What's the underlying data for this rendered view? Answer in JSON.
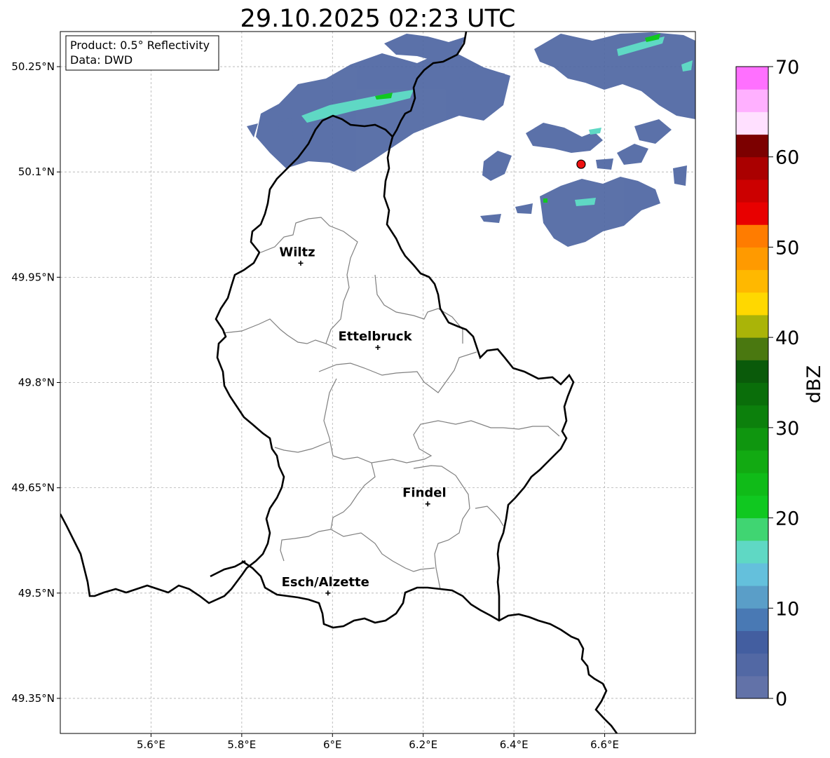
{
  "map": {
    "title": "29.10.2025 02:23 UTC",
    "info_box": {
      "product": "Product: 0.5° Reflectivity",
      "source": "Data: DWD"
    },
    "lon_range": [
      5.4,
      6.8
    ],
    "lat_range": [
      49.3,
      50.3
    ],
    "lon_ticks": [
      {
        "value": 5.6,
        "label": "5.6°E"
      },
      {
        "value": 5.8,
        "label": "5.8°E"
      },
      {
        "value": 6.0,
        "label": "6°E"
      },
      {
        "value": 6.2,
        "label": "6.2°E"
      },
      {
        "value": 6.4,
        "label": "6.4°E"
      },
      {
        "value": 6.6,
        "label": "6.6°E"
      }
    ],
    "lat_ticks": [
      {
        "value": 50.25,
        "label": "50.25°N"
      },
      {
        "value": 50.1,
        "label": "50.1°N"
      },
      {
        "value": 49.95,
        "label": "49.95°N"
      },
      {
        "value": 49.8,
        "label": "49.8°N"
      },
      {
        "value": 49.65,
        "label": "49.65°N"
      },
      {
        "value": 49.5,
        "label": "49.5°N"
      },
      {
        "value": 49.35,
        "label": "49.35°N"
      }
    ],
    "cities": [
      {
        "name": "Wiltz",
        "lon": 5.93,
        "lat": 49.97
      },
      {
        "name": "Ettelbruck",
        "lon": 6.1,
        "lat": 49.85
      },
      {
        "name": "Findel",
        "lon": 6.21,
        "lat": 49.627
      },
      {
        "name": "Esch/Alzette",
        "lon": 5.99,
        "lat": 49.5
      }
    ],
    "radar_site": {
      "lon": 6.548,
      "lat": 50.111,
      "color": "#ee1111"
    }
  },
  "colorbar": {
    "label": "dBZ",
    "min": 0,
    "max": 70,
    "step": 2.5,
    "tick_labels": [
      "0",
      "10",
      "20",
      "30",
      "40",
      "50",
      "60",
      "70"
    ],
    "colors": [
      "#6272a8",
      "#5268a4",
      "#435ea0",
      "#4979b4",
      "#5a9ec8",
      "#64c0dc",
      "#5fd8c4",
      "#40d572",
      "#10c820",
      "#10bb18",
      "#12aa12",
      "#0f960f",
      "#0c800c",
      "#0a6e0a",
      "#0a5a0a",
      "#4a7810",
      "#aab408",
      "#ffd800",
      "#ffb800",
      "#ff9a00",
      "#ff7c00",
      "#e80000",
      "#cc0000",
      "#aa0000",
      "#7c0000",
      "#ffe0ff",
      "#ffb0ff",
      "#ff70ff",
      "#e83ce8"
    ]
  }
}
